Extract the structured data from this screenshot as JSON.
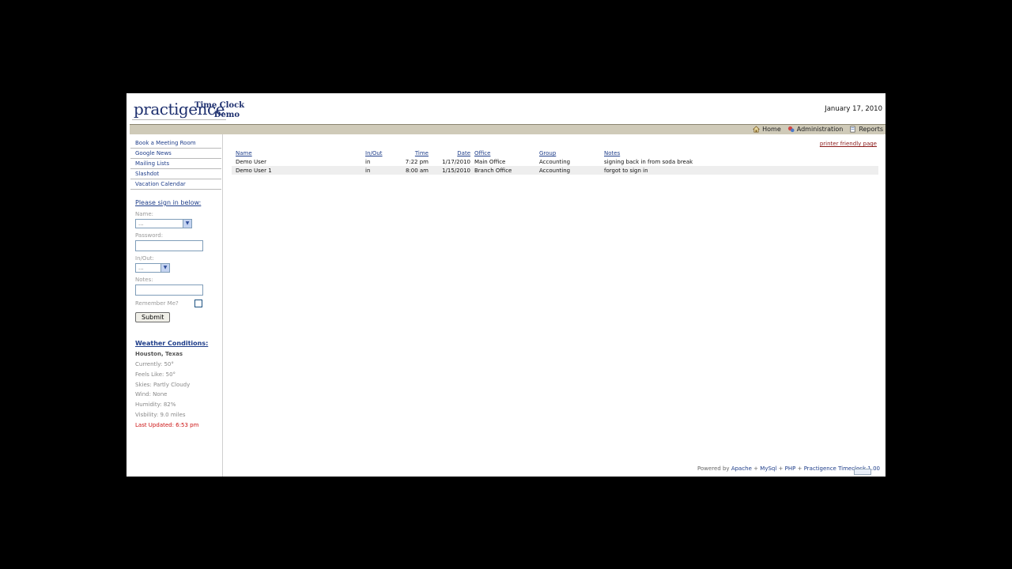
{
  "header": {
    "logo": "practigence",
    "subtitle_line1": "Time Clock",
    "subtitle_line2": "Demo",
    "date": "January 17, 2010"
  },
  "topnav": {
    "home": "Home",
    "administration": "Administration",
    "reports": "Reports"
  },
  "sidebar": {
    "links": [
      "Book a Meeting Room",
      "Google News",
      "Mailing Lists",
      "Slashdot",
      "Vacation Calendar"
    ],
    "signin_title": "Please sign in below:",
    "name_label": "Name:",
    "name_value": "...",
    "password_label": "Password:",
    "inout_label": "In/Out:",
    "inout_value": "...",
    "notes_label": "Notes:",
    "remember_label": "Remember Me?",
    "submit_label": "Submit"
  },
  "weather": {
    "title": "Weather Conditions:",
    "city": "Houston, Texas",
    "currently": "Currently: 50°",
    "feels_like": "Feels Like: 50°",
    "skies": "Skies: Partly Cloudy",
    "wind": "Wind: None",
    "humidity": "Humidity: 82%",
    "visibility": "Visbility: 9.0 miles",
    "last_updated": "Last Updated: 6:53 pm"
  },
  "main": {
    "printer_link": "printer friendly page",
    "columns": {
      "name": "Name",
      "inout": "In/Out",
      "time": "Time",
      "date": "Date",
      "office": "Office",
      "group": "Group",
      "notes": "Notes"
    },
    "rows": [
      {
        "name": "Demo User",
        "inout": "in",
        "time": "7:22 pm",
        "date": "1/17/2010",
        "office": "Main Office",
        "group": "Accounting",
        "notes": "signing back in from soda break"
      },
      {
        "name": "Demo User 1",
        "inout": "in",
        "time": "8:00 am",
        "date": "1/15/2010",
        "office": "Branch Office",
        "group": "Accounting",
        "notes": "forgot to sign in"
      }
    ]
  },
  "footer": {
    "powered_by": "Powered by",
    "apache": "Apache",
    "plus1": "+",
    "mysql": "MySql",
    "plus2": "+",
    "php": "PHP",
    "plus3": "+",
    "practigence": "Practigence Timeclock 1.00"
  }
}
